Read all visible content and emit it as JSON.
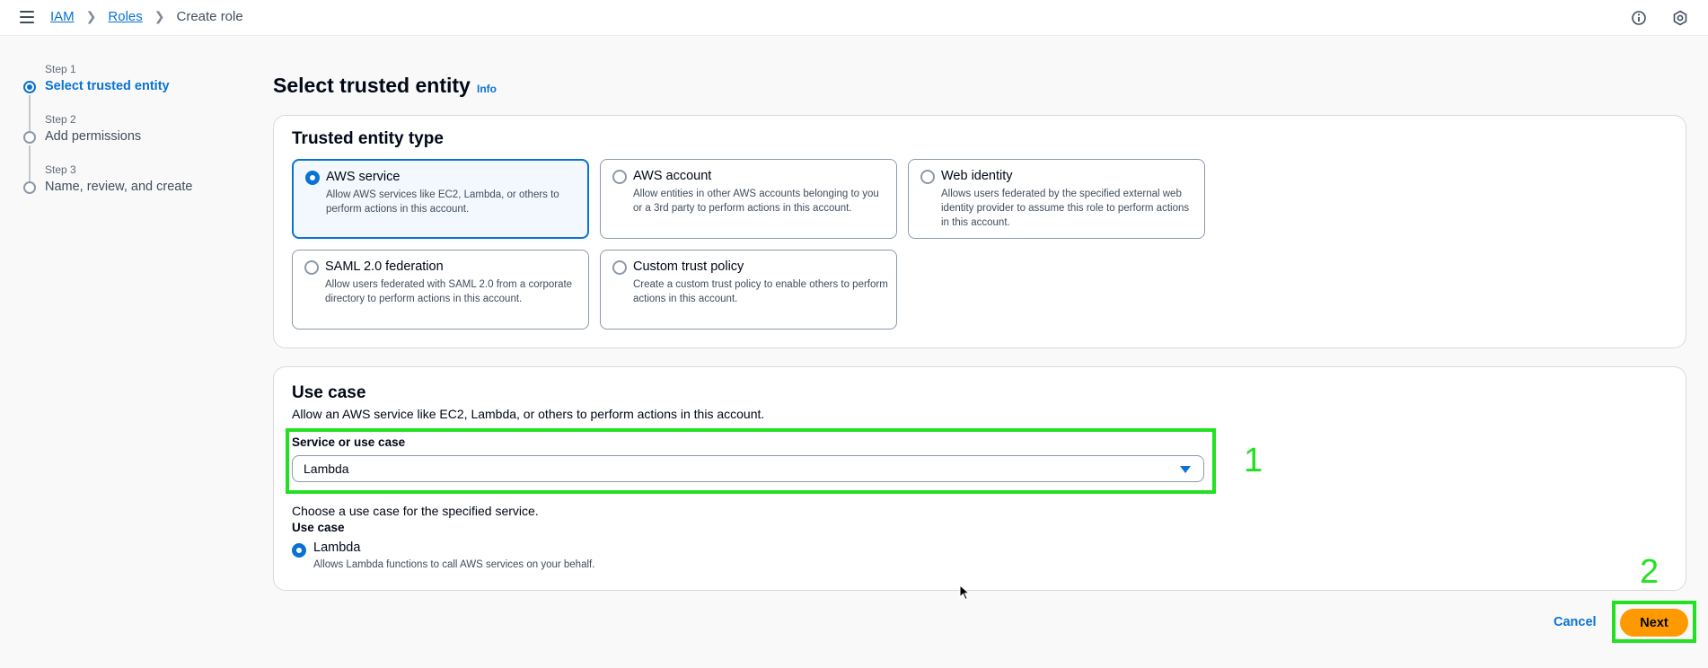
{
  "breadcrumb": {
    "iam": "IAM",
    "roles": "Roles",
    "current": "Create role"
  },
  "steps": [
    {
      "num": "Step 1",
      "label": "Select trusted entity"
    },
    {
      "num": "Step 2",
      "label": "Add permissions"
    },
    {
      "num": "Step 3",
      "label": "Name, review, and create"
    }
  ],
  "page": {
    "title": "Select trusted entity",
    "info": "Info"
  },
  "trusted_entity": {
    "title": "Trusted entity type",
    "options": [
      {
        "title": "AWS service",
        "desc": "Allow AWS services like EC2, Lambda, or others to perform actions in this account.",
        "selected": true
      },
      {
        "title": "AWS account",
        "desc": "Allow entities in other AWS accounts belonging to you or a 3rd party to perform actions in this account.",
        "selected": false
      },
      {
        "title": "Web identity",
        "desc": "Allows users federated by the specified external web identity provider to assume this role to perform actions in this account.",
        "selected": false
      },
      {
        "title": "SAML 2.0 federation",
        "desc": "Allow users federated with SAML 2.0 from a corporate directory to perform actions in this account.",
        "selected": false
      },
      {
        "title": "Custom trust policy",
        "desc": "Create a custom trust policy to enable others to perform actions in this account.",
        "selected": false
      }
    ]
  },
  "use_case": {
    "title": "Use case",
    "desc": "Allow an AWS service like EC2, Lambda, or others to perform actions in this account.",
    "service_label": "Service or use case",
    "service_value": "Lambda",
    "choose_text": "Choose a use case for the specified service.",
    "use_case_label": "Use case",
    "option_title": "Lambda",
    "option_desc": "Allows Lambda functions to call AWS services on your behalf."
  },
  "annotations": {
    "one": "1",
    "two": "2"
  },
  "actions": {
    "cancel": "Cancel",
    "next": "Next"
  },
  "colors": {
    "accent": "#0972d3",
    "primary_button": "#ff9900",
    "annotation": "#22e122"
  }
}
